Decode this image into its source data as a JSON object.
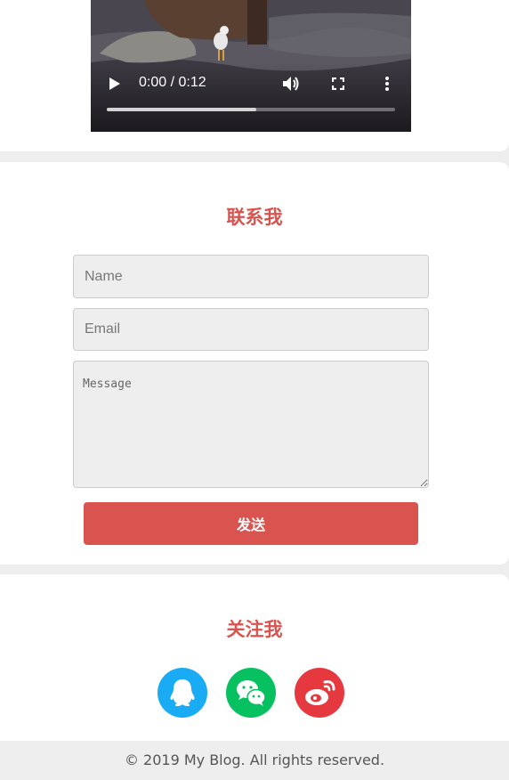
{
  "video": {
    "time_display": "0:00 / 0:12",
    "buffered_fraction": 0.52,
    "play_icon": "play-icon",
    "volume_icon": "volume-icon",
    "fullscreen_icon": "fullscreen-icon",
    "menu_icon": "more-vert-icon"
  },
  "contact": {
    "title": "联系我",
    "name_placeholder": "Name",
    "email_placeholder": "Email",
    "message_placeholder": "Message",
    "send_label": "发送"
  },
  "follow": {
    "title": "关注我",
    "icons": [
      {
        "name": "qq-icon",
        "color": "#1aabf5"
      },
      {
        "name": "wechat-icon",
        "color": "#07c160"
      },
      {
        "name": "weibo-icon",
        "color": "#e6393f"
      }
    ]
  },
  "footer": {
    "copyright": "© 2019 My Blog. All rights reserved."
  },
  "colors": {
    "accent": "#d9534f",
    "page_bg": "#eeeeee",
    "card_bg": "#ffffff"
  }
}
